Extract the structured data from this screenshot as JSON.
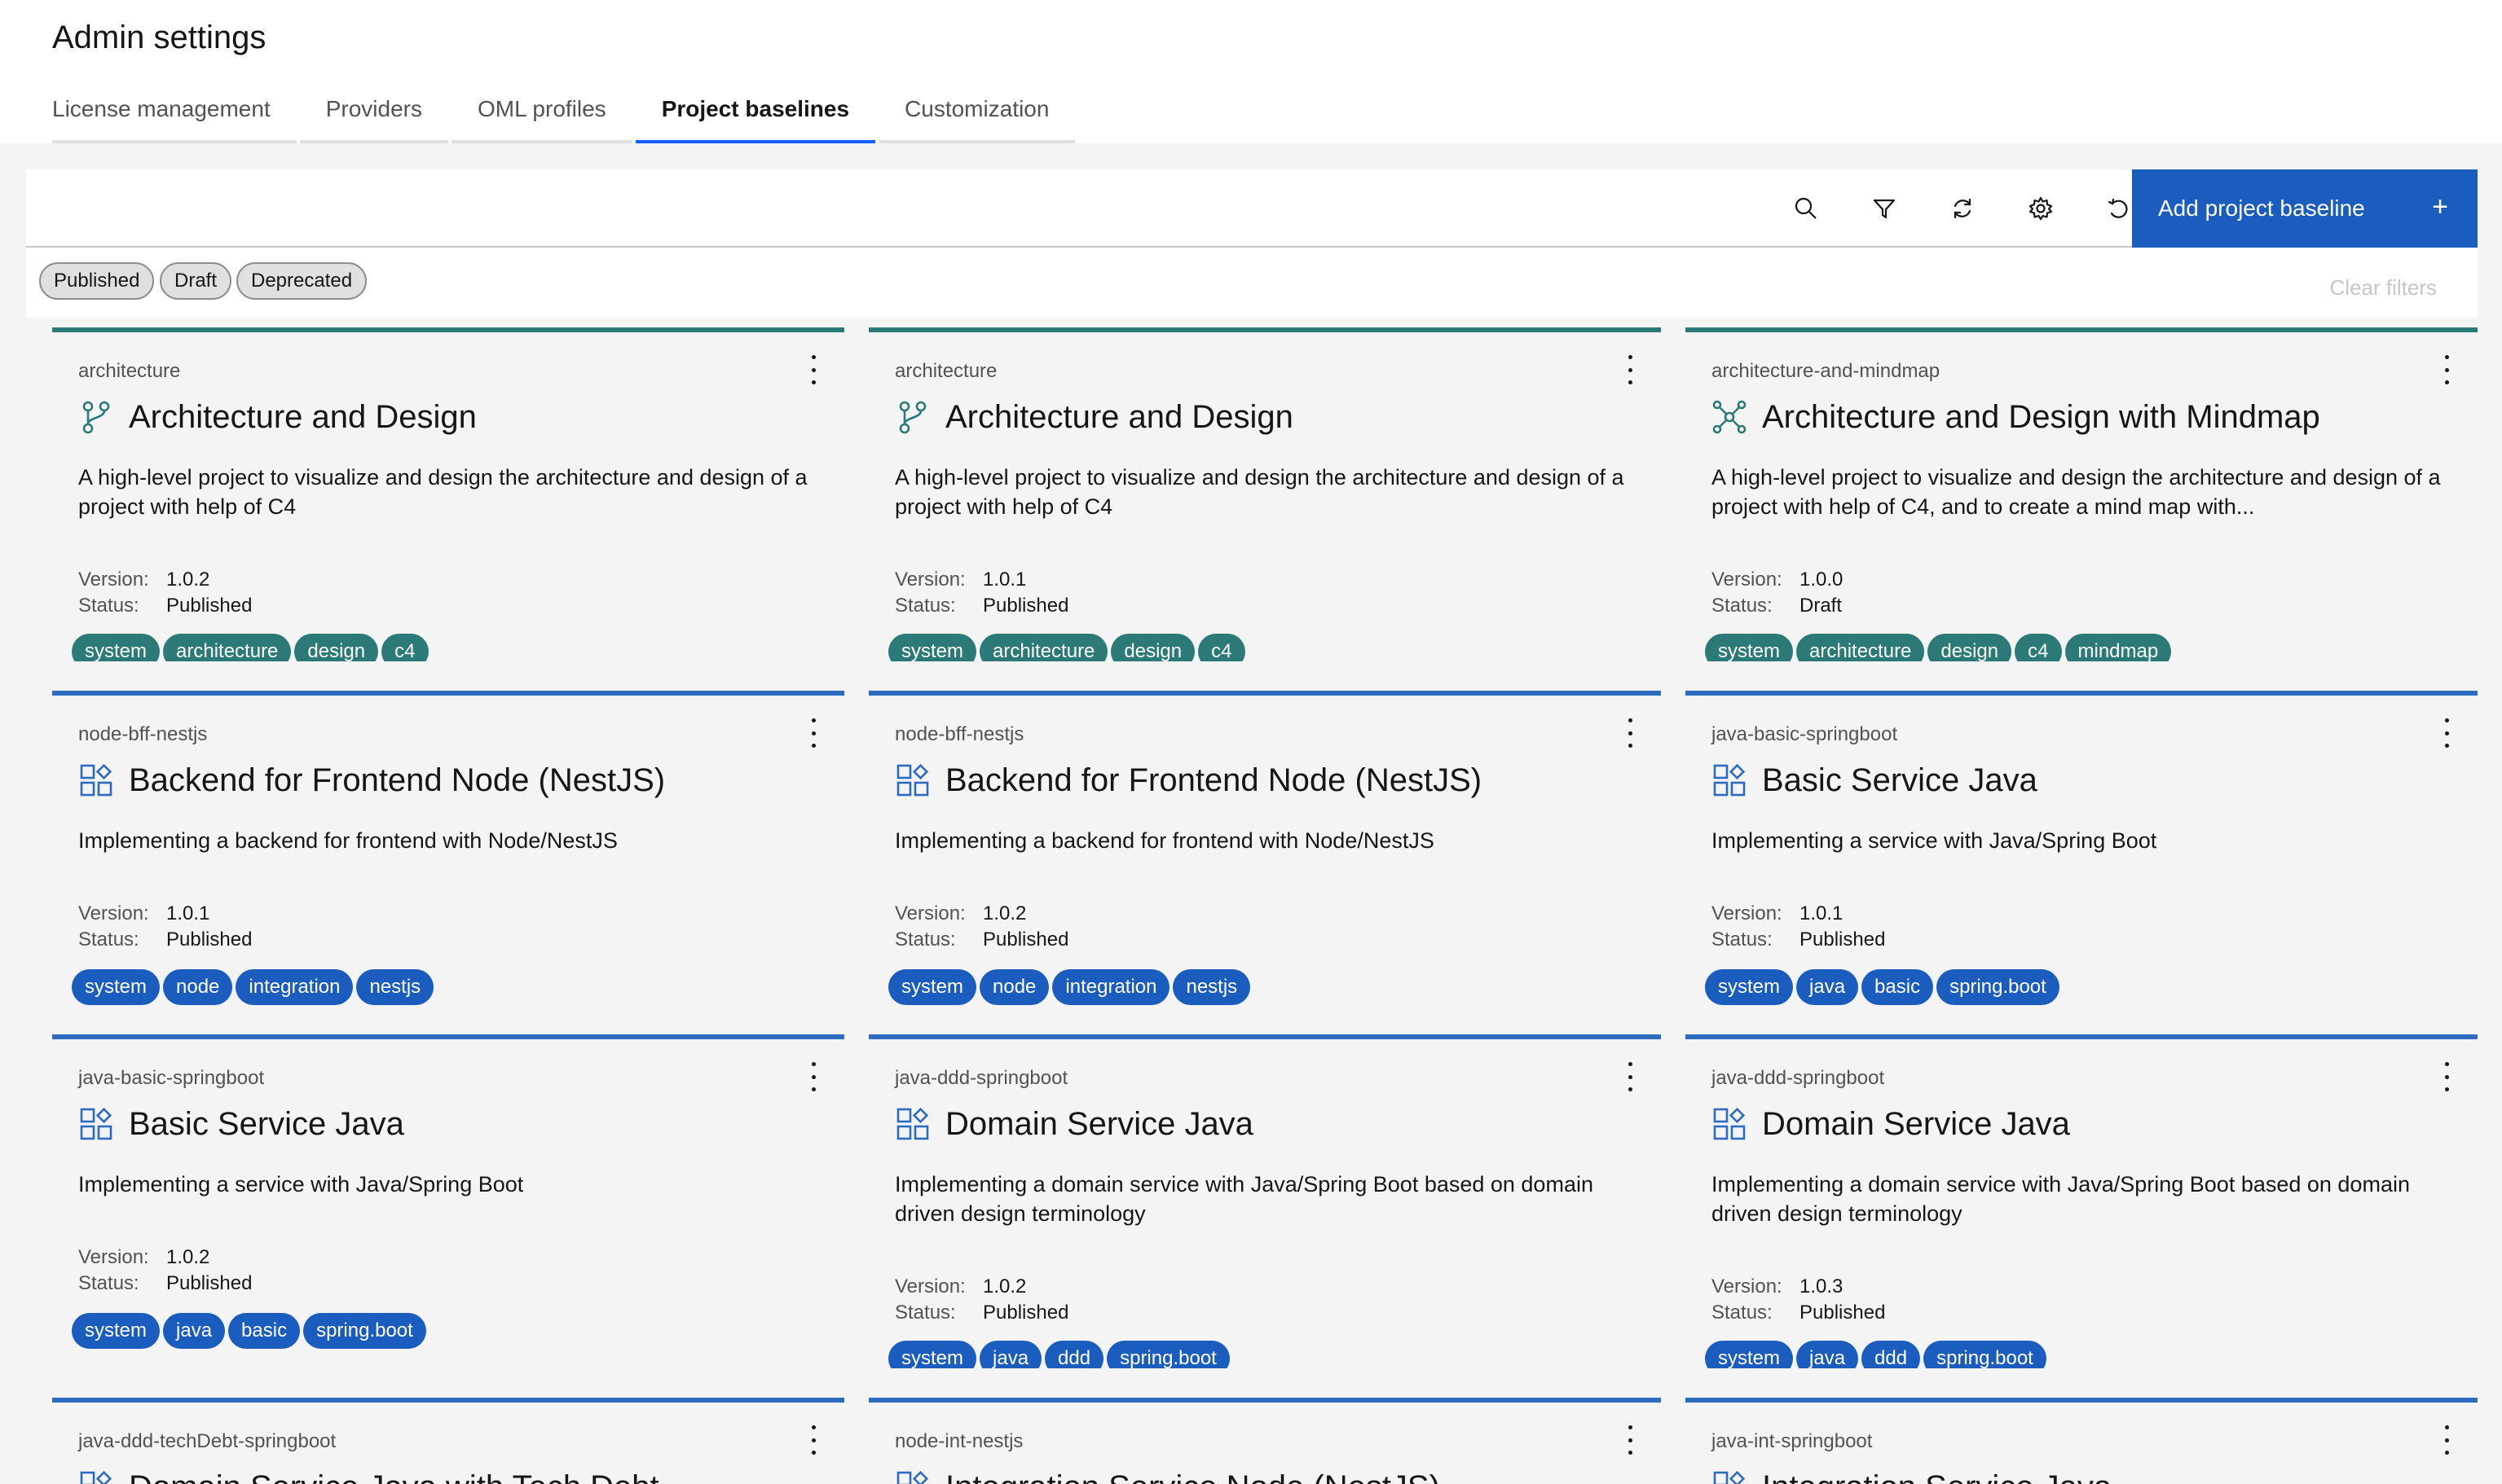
{
  "page": {
    "title": "Admin settings"
  },
  "tabs": [
    {
      "label": "License management",
      "active": false
    },
    {
      "label": "Providers",
      "active": false
    },
    {
      "label": "OML profiles",
      "active": false
    },
    {
      "label": "Project baselines",
      "active": true
    },
    {
      "label": "Customization",
      "active": false
    }
  ],
  "toolbar": {
    "icons": [
      "search-icon",
      "filter-icon",
      "refresh-icon",
      "settings-icon",
      "reset-icon"
    ],
    "add_button_label": "Add project baseline",
    "add_button_icon": "+"
  },
  "filters": {
    "chips": [
      "Published",
      "Draft",
      "Deprecated"
    ],
    "clear_label": "Clear filters"
  },
  "labels": {
    "version": "Version:",
    "status": "Status:"
  },
  "colors": {
    "accent_blue": "#1a5dbf",
    "accent_teal": "#2b7a78"
  },
  "cards": [
    {
      "id": "architecture",
      "title": "Architecture and Design",
      "icon": "branch-icon",
      "description": "A high-level project to visualize and design the architecture and design of a project with help of C4",
      "version": "1.0.2",
      "status": "Published",
      "tags": [
        "system",
        "architecture",
        "design",
        "c4"
      ],
      "color": "teal"
    },
    {
      "id": "architecture",
      "title": "Architecture and Design",
      "icon": "branch-icon",
      "description": "A high-level project to visualize and design the architecture and design of a project with help of C4",
      "version": "1.0.1",
      "status": "Published",
      "tags": [
        "system",
        "architecture",
        "design",
        "c4"
      ],
      "color": "teal"
    },
    {
      "id": "architecture-and-mindmap",
      "title": "Architecture and Design with Mindmap",
      "icon": "mindmap-icon",
      "description": "A high-level project to visualize and design the architecture and design of a project with help of C4, and to create a mind map with...",
      "version": "1.0.0",
      "status": "Draft",
      "tags": [
        "system",
        "architecture",
        "design",
        "c4",
        "mindmap"
      ],
      "color": "teal"
    },
    {
      "id": "node-bff-nestjs",
      "title": "Backend for Frontend Node (NestJS)",
      "icon": "blocks-icon",
      "description": "Implementing a backend for frontend with Node/NestJS",
      "version": "1.0.1",
      "status": "Published",
      "tags": [
        "system",
        "node",
        "integration",
        "nestjs"
      ],
      "color": "blue"
    },
    {
      "id": "node-bff-nestjs",
      "title": "Backend for Frontend Node (NestJS)",
      "icon": "blocks-icon",
      "description": "Implementing a backend for frontend with Node/NestJS",
      "version": "1.0.2",
      "status": "Published",
      "tags": [
        "system",
        "node",
        "integration",
        "nestjs"
      ],
      "color": "blue"
    },
    {
      "id": "java-basic-springboot",
      "title": "Basic Service Java",
      "icon": "blocks-icon",
      "description": "Implementing a service with Java/Spring Boot",
      "version": "1.0.1",
      "status": "Published",
      "tags": [
        "system",
        "java",
        "basic",
        "spring.boot"
      ],
      "color": "blue"
    },
    {
      "id": "java-basic-springboot",
      "title": "Basic Service Java",
      "icon": "blocks-icon",
      "description": "Implementing a service with Java/Spring Boot",
      "version": "1.0.2",
      "status": "Published",
      "tags": [
        "system",
        "java",
        "basic",
        "spring.boot"
      ],
      "color": "blue"
    },
    {
      "id": "java-ddd-springboot",
      "title": "Domain Service Java",
      "icon": "blocks-icon",
      "description": "Implementing a domain service with Java/Spring Boot based on domain driven design terminology",
      "version": "1.0.2",
      "status": "Published",
      "tags": [
        "system",
        "java",
        "ddd",
        "spring.boot"
      ],
      "color": "blue"
    },
    {
      "id": "java-ddd-springboot",
      "title": "Domain Service Java",
      "icon": "blocks-icon",
      "description": "Implementing a domain service with Java/Spring Boot based on domain driven design terminology",
      "version": "1.0.3",
      "status": "Published",
      "tags": [
        "system",
        "java",
        "ddd",
        "spring.boot"
      ],
      "color": "blue"
    },
    {
      "id": "java-ddd-techDebt-springboot",
      "title": "Domain Service Java with Tech Debt",
      "icon": "blocks-icon",
      "description": "",
      "version": "",
      "status": "",
      "tags": [],
      "color": "blue"
    },
    {
      "id": "node-int-nestjs",
      "title": "Integration Service Node (NestJS)",
      "icon": "blocks-icon",
      "description": "",
      "version": "",
      "status": "",
      "tags": [],
      "color": "blue"
    },
    {
      "id": "java-int-springboot",
      "title": "Integration Service Java",
      "icon": "blocks-icon",
      "description": "",
      "version": "",
      "status": "",
      "tags": [],
      "color": "blue"
    }
  ]
}
